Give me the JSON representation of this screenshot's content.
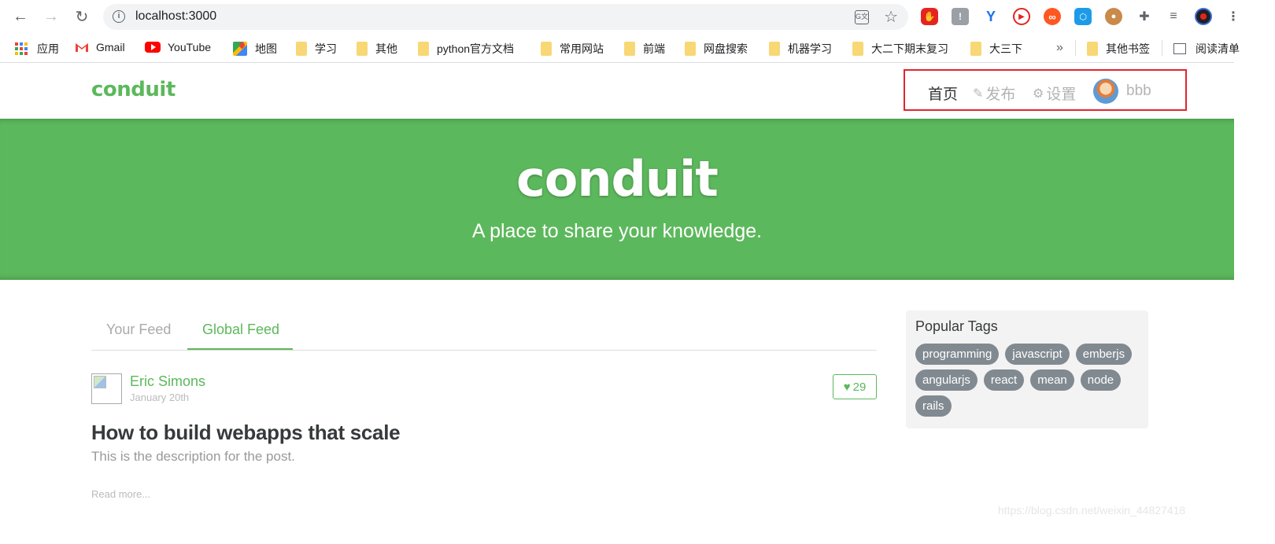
{
  "browser": {
    "url": "localhost:3000",
    "bookmarks": [
      {
        "label": "应用"
      },
      {
        "label": "Gmail"
      },
      {
        "label": "YouTube"
      },
      {
        "label": "地图"
      },
      {
        "label": "学习"
      },
      {
        "label": "其他"
      },
      {
        "label": "python官方文档"
      },
      {
        "label": "常用网站"
      },
      {
        "label": "前端"
      },
      {
        "label": "网盘搜索"
      },
      {
        "label": "机器学习"
      },
      {
        "label": "大二下期末复习"
      },
      {
        "label": "大三下"
      }
    ],
    "overflow_label": "»",
    "other_bookmarks": "其他书签",
    "reading_list": "阅读清单"
  },
  "navbar": {
    "brand": "conduit",
    "home": "首页",
    "new_post": "发布",
    "settings": "设置",
    "username": "bbb"
  },
  "banner": {
    "title": "conduit",
    "subtitle": "A place to share your knowledge."
  },
  "feed": {
    "tabs": [
      "Your Feed",
      "Global Feed"
    ],
    "active_tab": "Global Feed"
  },
  "article": {
    "author": "Eric Simons",
    "date": "January 20th",
    "likes": "29",
    "title": "How to build webapps that scale",
    "description": "This is the description for the post.",
    "read_more": "Read more..."
  },
  "sidebar": {
    "title": "Popular Tags",
    "tags": [
      "programming",
      "javascript",
      "emberjs",
      "angularjs",
      "react",
      "mean",
      "node",
      "rails"
    ]
  },
  "colors": {
    "brand": "#5cb85c",
    "tag": "#818a91",
    "highlight_box": "#e0252e"
  },
  "watermark": "https://blog.csdn.net/weixin_44827418"
}
